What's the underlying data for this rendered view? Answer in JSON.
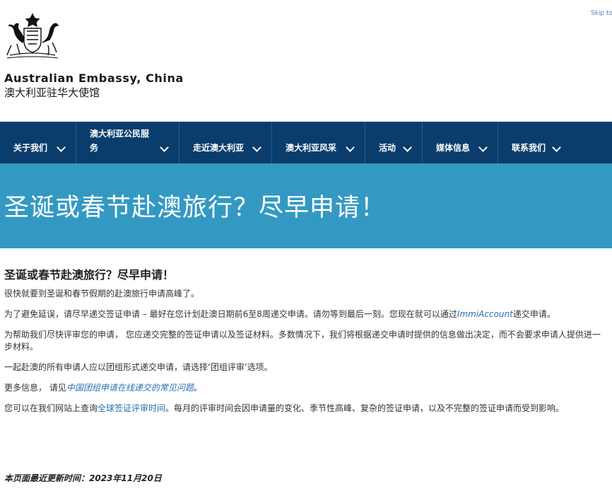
{
  "header": {
    "skip_link": "Skip to",
    "site_name_en": "Australian Embassy, China",
    "site_name_zh": "澳大利亚驻华大使馆"
  },
  "nav": {
    "items": [
      {
        "label": "关于我们"
      },
      {
        "label": "澳大利亚公民服务"
      },
      {
        "label": "走近澳大利亚"
      },
      {
        "label": "澳大利亚风采"
      },
      {
        "label": "活动"
      },
      {
        "label": "媒体信息"
      },
      {
        "label": "联系我们"
      }
    ]
  },
  "banner": {
    "title": "圣诞或春节赴澳旅行？尽早申请！"
  },
  "main": {
    "heading": "圣诞或春节赴澳旅行？尽早申请！",
    "p1": "很快就要到圣诞和春节假期的赴澳旅行申请高峰了。",
    "p2_before": "为了避免延误，请尽早递交签证申请 – 最好在您计划赴澳日期前6至8周递交申请。请勿等到最后一刻。您现在就可以通过",
    "p2_link": "ImmiAccount",
    "p2_after": "递交申请。",
    "p3": "为帮助我们尽快评审您的申请， 您应递交完整的签证申请以及签证材料。多数情况下，我们将根据递交申请时提供的信息做出决定，而不会要求申请人提供进一步材料。",
    "p4": "一起赴澳的所有申请人应以团组形式递交申请，请选择‘团组评审’选项。",
    "p5_before": "更多信息， 请见",
    "p5_link": "中国团组申请在线递交的常见问题",
    "p5_after": "。",
    "p6_before": "您可以在我们网站上查询",
    "p6_link": "全球签证评审时间",
    "p6_after": "。每月的评审时间会因申请量的变化、季节性高峰、复杂的签证申请，以及不完整的签证申请而受到影响。"
  },
  "footer": {
    "last_updated": "本页面最近更新时间：2023年11月20日"
  },
  "colors": {
    "nav_bg": "#0a3d6b",
    "banner_bg": "#3399c3",
    "link": "#2a6db5"
  }
}
